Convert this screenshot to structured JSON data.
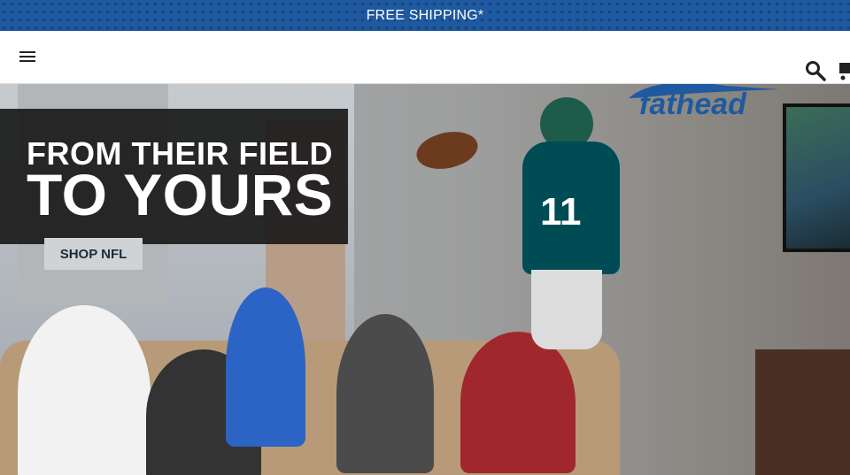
{
  "promo": {
    "text": "FREE SHIPPING*"
  },
  "header": {
    "menu_icon": "hamburger-icon",
    "search_icon": "search-icon",
    "cart_icon": "cart-icon"
  },
  "hero": {
    "brand": "fathead",
    "headline_line1": "FROM THEIR FIELD",
    "headline_line2": "TO YOURS",
    "cta_label": "SHOP NFL",
    "jersey_number": "11"
  },
  "colors": {
    "brand_blue": "#1f5aa0",
    "overlay": "#1a1a1a",
    "button_bg": "#cfd3d6"
  }
}
